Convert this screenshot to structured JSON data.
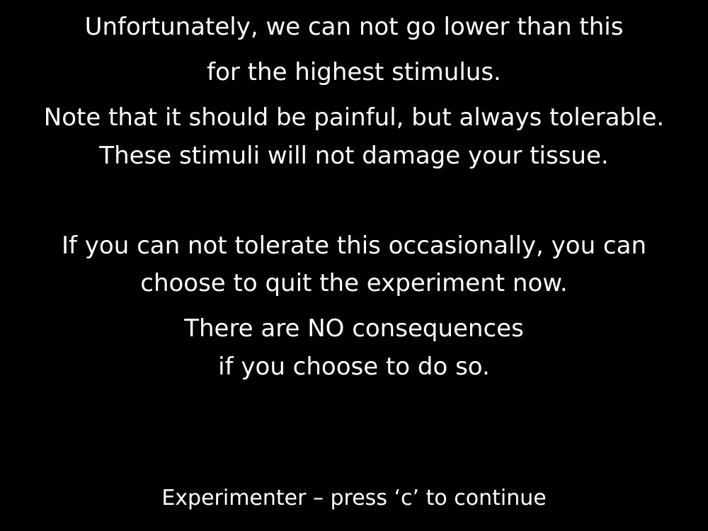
{
  "colors": {
    "background": "#000000",
    "text": "#ffffff"
  },
  "message": {
    "paragraph_1": [
      "Unfortunately, we can not go lower than this",
      "for the highest stimulus."
    ],
    "paragraph_2": [
      "Note that it should be painful, but always tolerable.",
      "These stimuli will not damage your tissue."
    ],
    "paragraph_3": [
      "If you can not tolerate this occasionally, you can",
      "choose to quit the experiment now."
    ],
    "paragraph_4": [
      "There are NO consequences",
      "if you choose to do so."
    ]
  },
  "footer": {
    "instruction": "Experimenter – press ‘c’ to continue"
  }
}
